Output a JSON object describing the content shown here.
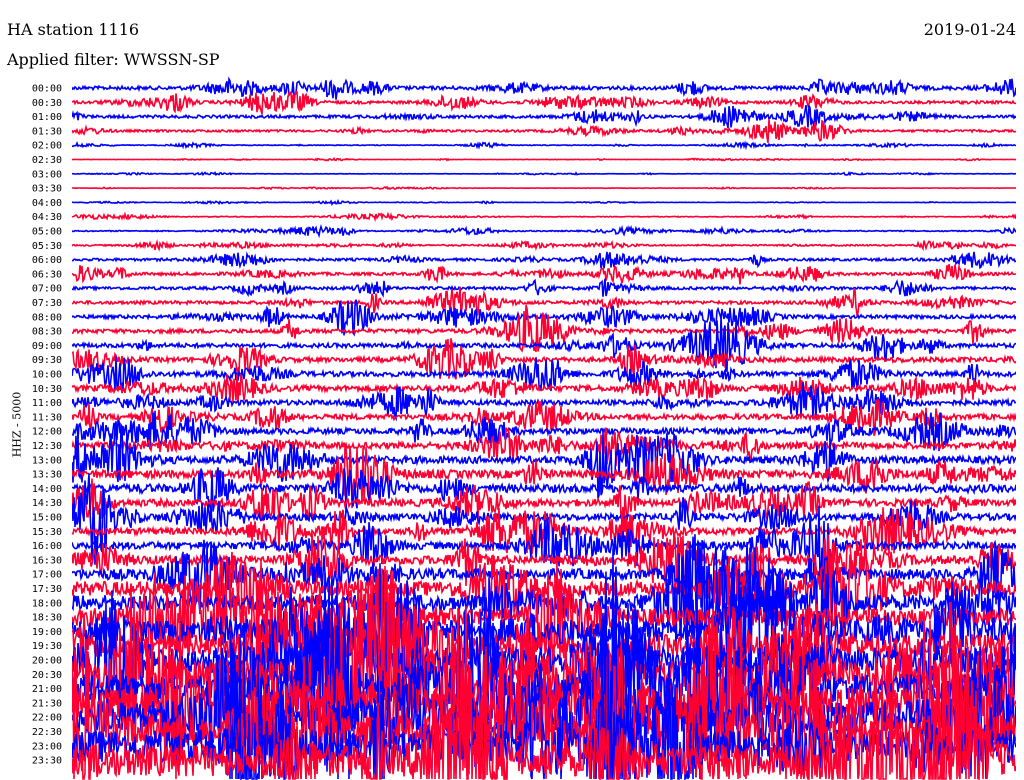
{
  "header": {
    "station": "HA station 1116",
    "filter": "Applied filter: WWSSN-SP",
    "date": "2019-01-24"
  },
  "chart_data": {
    "type": "line",
    "title": "HA station 1116",
    "ylabel": "HHZ - 5000",
    "colors": [
      "#0000ff",
      "#ff0033"
    ],
    "rows": [
      "00:00",
      "00:30",
      "01:00",
      "01:30",
      "02:00",
      "02:30",
      "03:00",
      "03:30",
      "04:00",
      "04:30",
      "05:00",
      "05:30",
      "06:00",
      "06:30",
      "07:00",
      "07:30",
      "08:00",
      "08:30",
      "09:00",
      "09:30",
      "10:00",
      "10:30",
      "11:00",
      "11:30",
      "12:00",
      "12:30",
      "13:00",
      "13:30",
      "14:00",
      "14:30",
      "15:00",
      "15:30",
      "16:00",
      "16:30",
      "17:00",
      "17:30",
      "18:00",
      "18:30",
      "19:00",
      "19:30",
      "20:00",
      "20:30",
      "21:00",
      "21:30",
      "22:00",
      "22:30",
      "23:00",
      "23:30"
    ],
    "activity": [
      0.5,
      0.4,
      0.4,
      0.3,
      0.1,
      0.05,
      0.05,
      0.05,
      0.05,
      0.1,
      0.15,
      0.2,
      0.35,
      0.4,
      0.4,
      0.45,
      0.5,
      0.55,
      0.6,
      0.65,
      0.7,
      0.75,
      0.7,
      0.75,
      0.8,
      0.85,
      1.0,
      1.1,
      1.1,
      1.0,
      0.9,
      0.9,
      1.0,
      1.2,
      1.5,
      2.0,
      2.2,
      2.5,
      3.0,
      3.2,
      3.5,
      3.8,
      4.0,
      4.2,
      4.5,
      4.5,
      4.5,
      4.5
    ]
  }
}
